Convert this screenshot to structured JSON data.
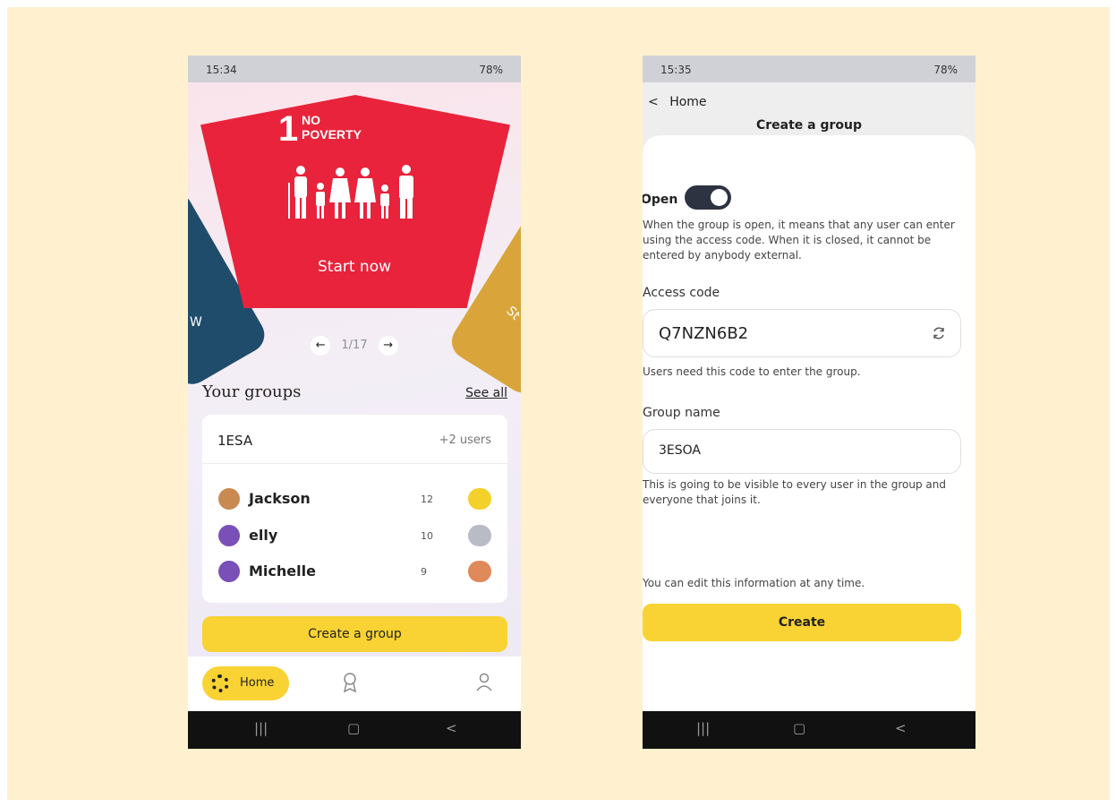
{
  "phone1": {
    "status": {
      "time": "15:34",
      "right": "78%"
    },
    "sdg": {
      "number": "1",
      "title": "NO POVERTY",
      "cta": "Start now",
      "left_letter": "W",
      "right_letter": "St"
    },
    "pager": {
      "prev": "←",
      "page": "1/17",
      "next": "→"
    },
    "groups": {
      "title": "Your groups",
      "see_all": "See all",
      "group_name": "1ESA",
      "group_users": "+2 users",
      "members": [
        {
          "name": "Jackson",
          "score": "12",
          "avatar_color": "#c98a52",
          "medal_color": "#f4d12a"
        },
        {
          "name": "elly",
          "score": "10",
          "avatar_color": "#7a4fb7",
          "medal_color": "#b8bcc6"
        },
        {
          "name": "Michelle",
          "score": "9",
          "avatar_color": "#7a4fb7",
          "medal_color": "#e0895b"
        }
      ]
    },
    "create_group": "Create a group",
    "tabbar": {
      "home": "Home"
    },
    "nav": {
      "recent": "|||",
      "home": "▢",
      "back": "<"
    }
  },
  "phone2": {
    "status": {
      "time": "15:35",
      "right": "78%"
    },
    "back": {
      "chev": "<",
      "label": "Home"
    },
    "title": "Create a group",
    "open_label": "Open",
    "open_desc": "When the group is open, it means that any user can enter using the access code. When it is closed, it cannot be entered by anybody external.",
    "access_label": "Access code",
    "access_value": "Q7NZN6B2",
    "access_hint": "Users need this code to enter the group.",
    "name_label": "Group name",
    "name_value": "3ESOA",
    "name_hint": "This is going to be visible to every user in the group and everyone that joins it.",
    "edit_note": "You can edit this information at any time.",
    "create": "Create",
    "nav": {
      "recent": "|||",
      "home": "▢",
      "back": "<"
    }
  },
  "colors": {
    "accent": "#f8d333",
    "sdg_red": "#e8233b",
    "toggle_on": "#2e3342"
  }
}
